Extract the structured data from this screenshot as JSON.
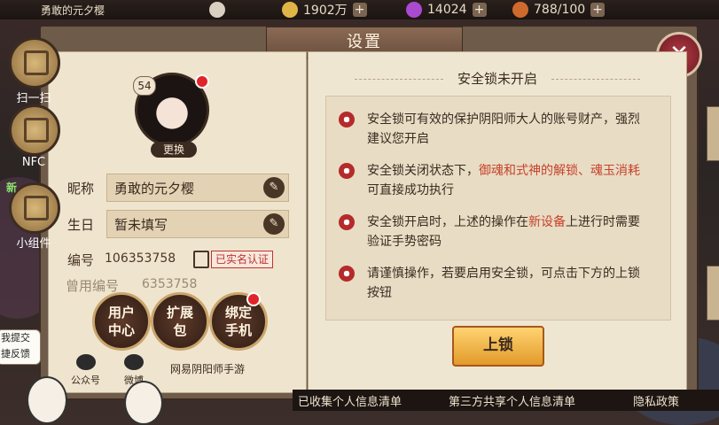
{
  "topbar": {
    "player_name": "勇敢的元夕樱",
    "gold": "1902万",
    "jade": "14024",
    "stamina": "788/100",
    "plus": "+"
  },
  "settings": {
    "title": "设置",
    "close": "✕"
  },
  "side_buttons": {
    "scan": "扫一扫",
    "nfc": "NFC",
    "widget": "小组件",
    "widget_new": "新"
  },
  "profile": {
    "level": "54",
    "change_label": "更换",
    "nickname_label": "昵称",
    "nickname_value": "勇敢的元夕樱",
    "birthday_label": "生日",
    "birthday_value": "暂未填写",
    "id_label": "编号",
    "id_value": "106353758",
    "verified_label": "已实名认证",
    "old_id_label": "曾用编号",
    "old_id_value": "6353758"
  },
  "action_buttons": {
    "user_center": "用户\n中心",
    "expansion": "扩展\n包",
    "bind_phone": "绑定\n手机"
  },
  "social": {
    "wechat": "公众号",
    "weibo": "微博",
    "netease": "网易阴阳师手游"
  },
  "security": {
    "title": "安全锁未开启",
    "item1": "安全锁可有效的保护阴阳师大人的账号财产，强烈建议您开启",
    "item2_pre": "安全锁关闭状态下，",
    "item2_hl": "御魂和式神的解锁、魂玉消耗",
    "item2_post": "可直接成功执行",
    "item3_pre": "安全锁开启时，上述的操作在",
    "item3_hl": "新设备",
    "item3_post": "上进行时需要验证手势密码",
    "item4": "请谨慎操作，若要启用安全锁，可点击下方的上锁按钮",
    "lock_button": "上锁"
  },
  "bottom_links": {
    "collected_info": "已收集个人信息清单",
    "third_party": "第三方共享个人信息清单",
    "privacy": "隐私政策"
  },
  "feedback_bubble": "我提交\n捷反馈",
  "colors": {
    "highlight_red": "#c7412b",
    "lock_orange": "#e29a2a",
    "close_red": "#b23a45"
  }
}
